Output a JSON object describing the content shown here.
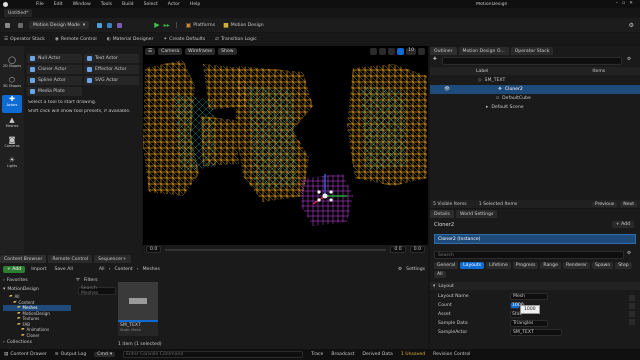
{
  "window": {
    "app_title": "MotionDesign",
    "level_name": "Untitled*"
  },
  "menu": [
    "File",
    "Edit",
    "Window",
    "Tools",
    "Build",
    "Select",
    "Actor",
    "Help"
  ],
  "toolbar": {
    "mode_dropdown": "Motion Design Mode",
    "platforms": "Platforms",
    "motion_design": "Motion Design"
  },
  "secondary_toolbar": {
    "items": [
      "Operator Stack",
      "Remote Control",
      "Material Designer",
      "Create Defaults",
      "Transition Logic"
    ]
  },
  "modes": [
    "2D Shapes",
    "3D Shapes",
    "Actors",
    "Meshes",
    "Cameras",
    "Lights"
  ],
  "palette": {
    "actors": [
      {
        "label": "Null Actor",
        "color": "#6aa6e6"
      },
      {
        "label": "Text Actor",
        "color": "#6aa6e6"
      },
      {
        "label": "Cloner Actor",
        "color": "#6aa6e6"
      },
      {
        "label": "Effector Actor",
        "color": "#6aa6e6"
      },
      {
        "label": "Spline Actor",
        "color": "#6aa6e6"
      },
      {
        "label": "SVG Actor",
        "color": "#6aa6e6"
      },
      {
        "label": "Media Plate",
        "color": "#6aa6e6"
      }
    ],
    "hint_line1": "Select a tool to start drawing.",
    "hint_line2": "Shift click will show tool presets, if available."
  },
  "viewport": {
    "camera": "Camera",
    "view_mode": "Wireframe",
    "show": "Show",
    "counter": "10",
    "timeline_start": "0.0",
    "timeline_mid": "0.0",
    "timeline_end": "0.0"
  },
  "outliner": {
    "tabs": [
      "Outliner",
      "Motion Design O...",
      "Operator Stack"
    ],
    "col_label": "Label",
    "col_items": "Items",
    "rows": [
      {
        "label": "SM_TEXT",
        "indent": 0,
        "selected": false
      },
      {
        "label": "Cloner2",
        "indent": 1,
        "selected": true
      },
      {
        "label": "DefaultCube",
        "indent": 2,
        "selected": false
      },
      {
        "label": "Default Scene",
        "indent": 1,
        "selected": false
      }
    ],
    "visible_items": "5 Visible Items",
    "selected_items": "1 Selected Items",
    "previous": "Previous",
    "next": "Next"
  },
  "details": {
    "tabs": [
      "Details",
      "World Settings"
    ],
    "actor_name": "Cloner2",
    "add_label": "+ Add",
    "instance_label": "Cloner2 (Instance)",
    "search_placeholder": "Search",
    "filter_tabs": [
      "General",
      "Layouts",
      "Lifetime",
      "Progress",
      "Range",
      "Renderer",
      "Spawn",
      "Step"
    ],
    "filter_tab_all": "All",
    "section": "Layout",
    "props": [
      {
        "name": "Layout Name",
        "value": "Mesh"
      },
      {
        "name": "Count",
        "value": "1000"
      },
      {
        "name": "Asset",
        "value": "Stat"
      },
      {
        "name": "Sample Data",
        "value": "Triangles"
      },
      {
        "name": "SampleActor",
        "value": "SM_TEXT"
      }
    ],
    "tooltip": "1000"
  },
  "bottom_tabs": [
    "Content Browser",
    "Remote Control",
    "Sequencer+"
  ],
  "content_browser": {
    "add": "+ Add",
    "import": "Import",
    "save_all": "Save All",
    "path": [
      "All",
      "Content",
      "Meshes"
    ],
    "settings": "Settings",
    "favorites": "Favorites",
    "project": "MotionDesign",
    "tree": [
      {
        "label": "All",
        "level": 0
      },
      {
        "label": "Content",
        "level": 1
      },
      {
        "label": "Meshes",
        "level": 2
      },
      {
        "label": "MotionDesign",
        "level": 2
      },
      {
        "label": "Textures",
        "level": 2
      },
      {
        "label": "FAB",
        "level": 2
      },
      {
        "label": "Animations",
        "level": 3
      },
      {
        "label": "Cloner",
        "level": 3
      }
    ],
    "filters": "Filters",
    "search_placeholder": "Search Meshes",
    "asset_name": "SM_TEXT",
    "asset_type": "Static Mesh",
    "items_status": "1 item (1 selected)",
    "collections": "Collections"
  },
  "statusbar": {
    "content_drawer": "Content Drawer",
    "output_log": "Output Log",
    "cmd": "Cmd",
    "console_placeholder": "Enter Console Command",
    "trace": "Trace",
    "broadcast": "Broadcast",
    "derived_data": "Derived Data",
    "unsaved": "1 Unsaved",
    "revision_control": "Revision Control"
  },
  "colors": {
    "accent": "#0e6bd3",
    "wire_orange": "#e8a21c",
    "wire_teal": "#2aa6a0",
    "wire_magenta": "#b83ad8"
  }
}
